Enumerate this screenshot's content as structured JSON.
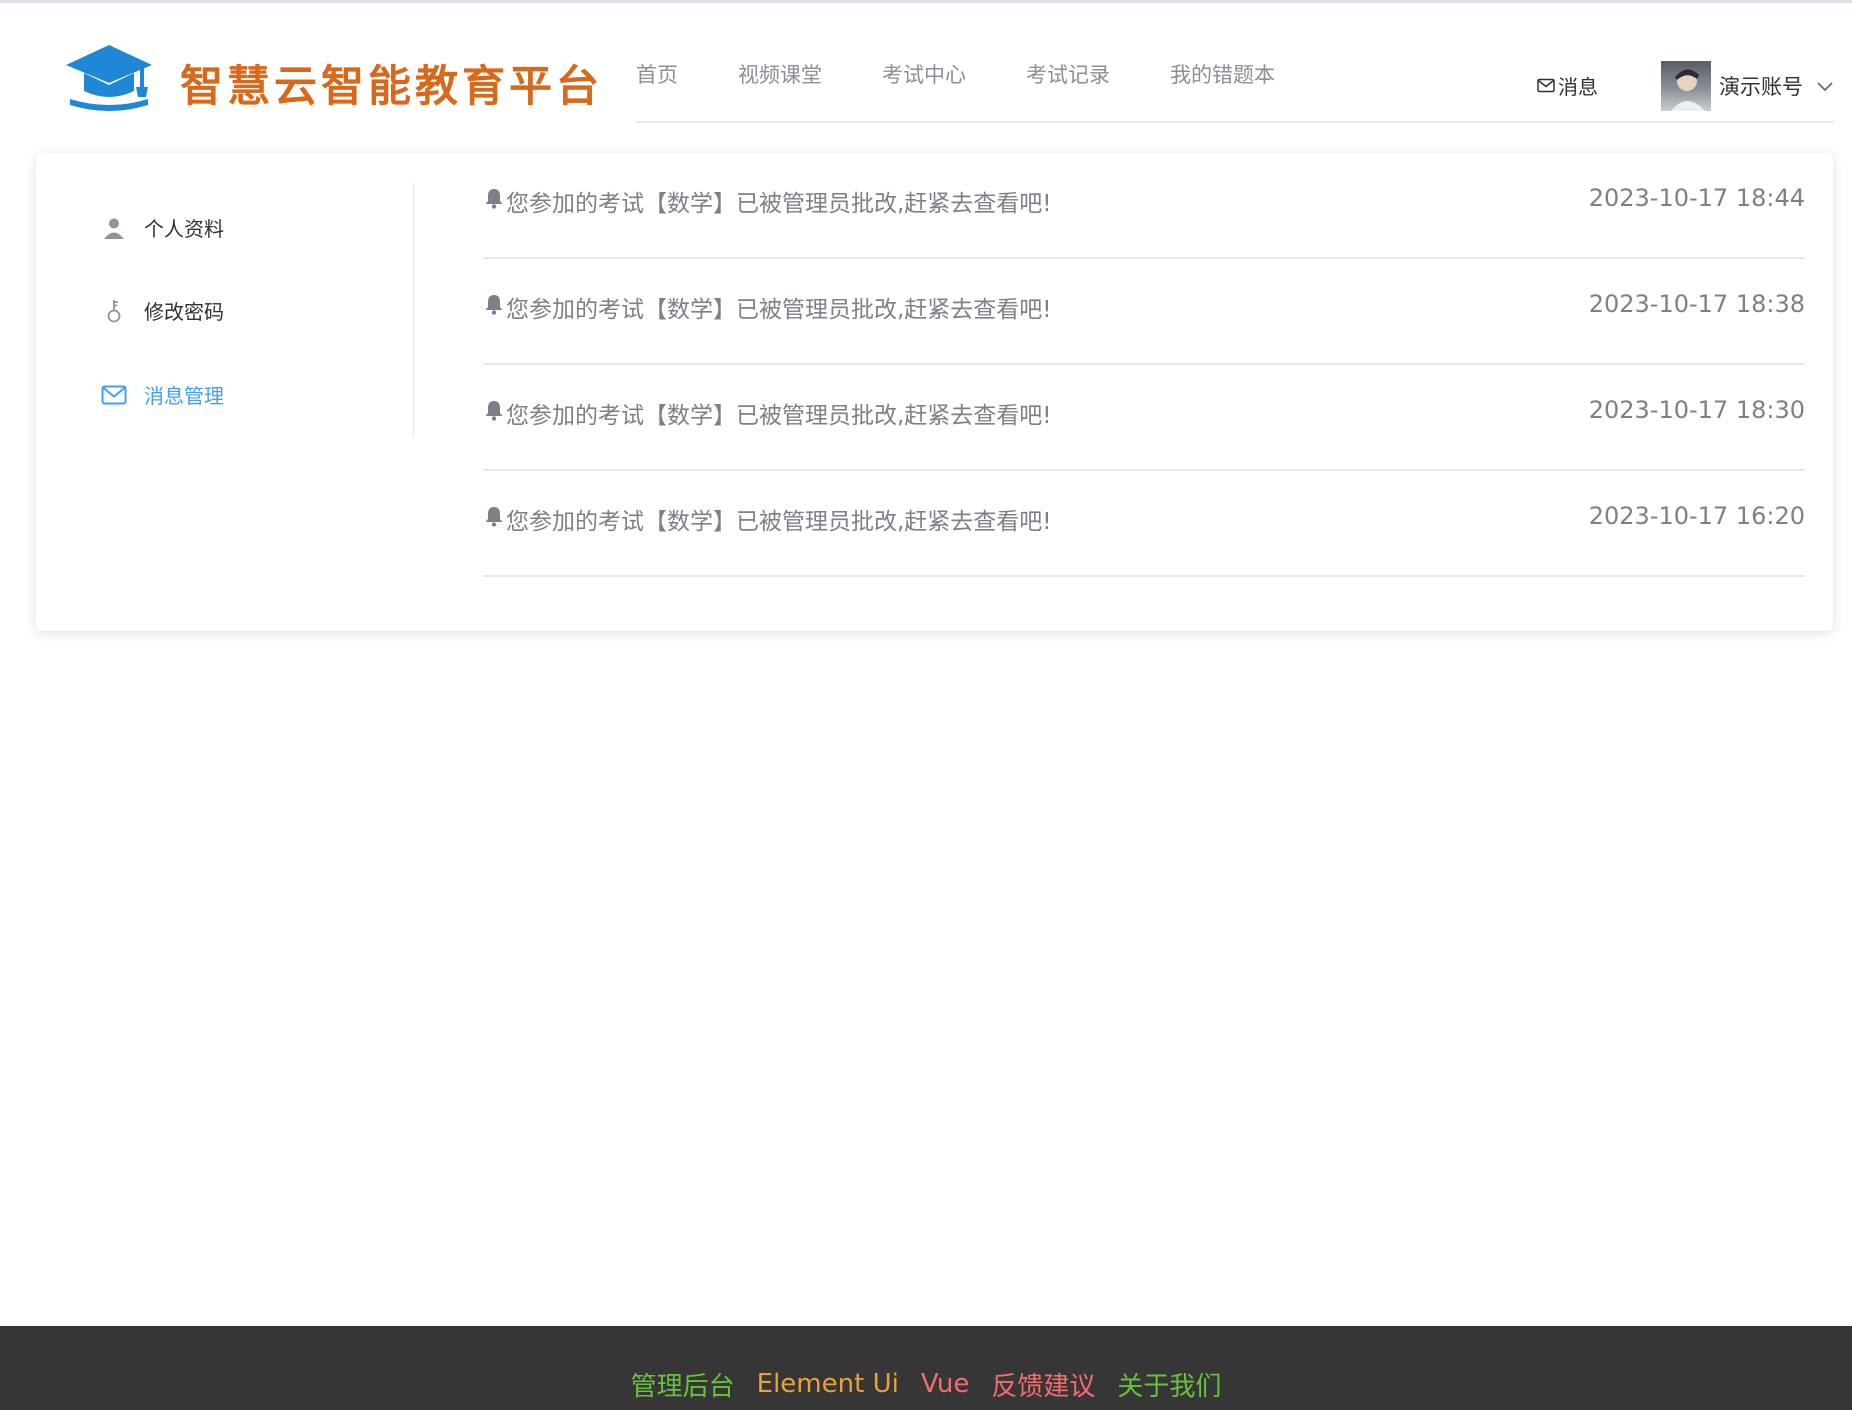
{
  "brand": {
    "name": "智慧云智能教育平台",
    "logo_icon": "graduation-cap-icon",
    "logo_color": "#1e88d6",
    "text_color": "#d8681a"
  },
  "nav": {
    "items": [
      {
        "label": "首页"
      },
      {
        "label": "视频课堂"
      },
      {
        "label": "考试中心"
      },
      {
        "label": "考试记录"
      },
      {
        "label": "我的错题本"
      }
    ]
  },
  "header": {
    "messages_label": "消息",
    "user_name": "演示账号"
  },
  "side_menu": {
    "items": [
      {
        "label": "个人资料",
        "icon": "user-icon"
      },
      {
        "label": "修改密码",
        "icon": "key-icon"
      },
      {
        "label": "消息管理",
        "icon": "mail-icon",
        "active": true
      }
    ],
    "active_color": "#409eff"
  },
  "messages": [
    {
      "text": "您参加的考试【数学】已被管理员批改,赶紧去查看吧!",
      "time": "2023-10-17 18:44"
    },
    {
      "text": "您参加的考试【数学】已被管理员批改,赶紧去查看吧!",
      "time": "2023-10-17 18:38"
    },
    {
      "text": "您参加的考试【数学】已被管理员批改,赶紧去查看吧!",
      "time": "2023-10-17 18:30"
    },
    {
      "text": "您参加的考试【数学】已被管理员批改,赶紧去查看吧!",
      "time": "2023-10-17 16:20"
    }
  ],
  "footer": {
    "links": [
      {
        "label": "管理后台",
        "color": "#67c23a"
      },
      {
        "label": "Element Ui",
        "color": "#e6a23c"
      },
      {
        "label": "Vue",
        "color": "#f56c6c"
      },
      {
        "label": "反馈建议",
        "color": "#f56c6c"
      },
      {
        "label": "关于我们",
        "color": "#67c23a"
      }
    ]
  }
}
